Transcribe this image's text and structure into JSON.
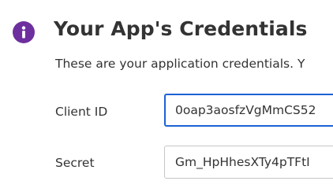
{
  "colors": {
    "accent": "#6e2f9e",
    "focus_border": "#1c62d6"
  },
  "header": {
    "icon": "info-icon",
    "title": "Your App's Credentials",
    "subtitle": "These are your application credentials. Y"
  },
  "fields": {
    "client_id": {
      "label": "Client ID",
      "value": "0oap3aosfzVgMmCS52"
    },
    "secret": {
      "label": "Secret",
      "value": "Gm_HpHhesXTy4pTFtI"
    }
  }
}
